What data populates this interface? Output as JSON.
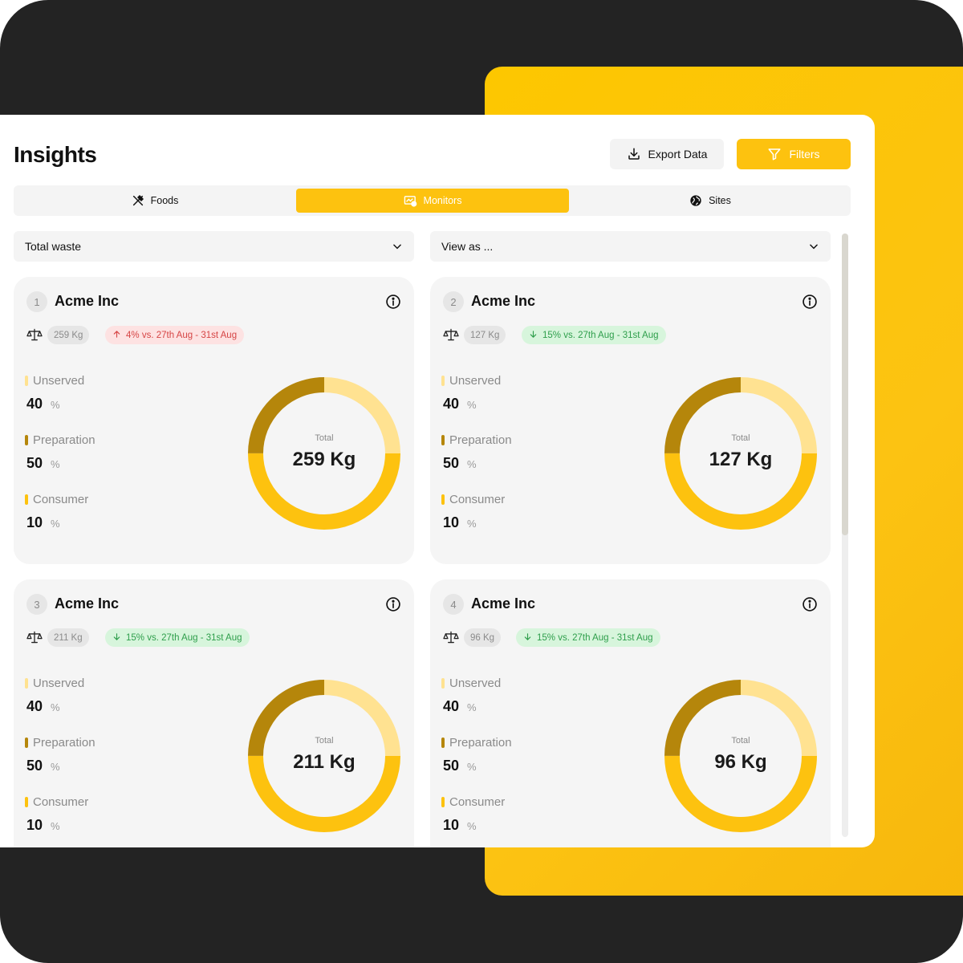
{
  "page": {
    "title": "Insights"
  },
  "toolbar": {
    "export_label": "Export Data",
    "filters_label": "Filters"
  },
  "tabs": [
    {
      "label": "Foods",
      "icon": "fork-knife-icon",
      "active": false
    },
    {
      "label": "Monitors",
      "icon": "monitor-icon",
      "active": true
    },
    {
      "label": "Sites",
      "icon": "globe-icon",
      "active": false
    }
  ],
  "selects": {
    "metric": "Total waste",
    "view": "View as ..."
  },
  "colors": {
    "accent": "#fdc20f",
    "unserved": "#ffe291",
    "preparation": "#b5860b",
    "consumer": "#fdc20f",
    "trend_up_text": "#d64545",
    "trend_down_text": "#2e9e4b"
  },
  "legend_labels": {
    "unserved": "Unserved",
    "preparation": "Preparation",
    "consumer": "Consumer"
  },
  "unit": "%",
  "total_label": "Total",
  "cards": [
    {
      "index": "1",
      "name": "Acme Inc",
      "weight": "259 Kg",
      "trend": {
        "direction": "up",
        "text": "4% vs. 27th Aug - 31st Aug"
      },
      "unserved": 40,
      "preparation": 50,
      "consumer": 10,
      "total": "259 Kg"
    },
    {
      "index": "2",
      "name": "Acme Inc",
      "weight": "127 Kg",
      "trend": {
        "direction": "down",
        "text": "15% vs. 27th Aug - 31st Aug"
      },
      "unserved": 40,
      "preparation": 50,
      "consumer": 10,
      "total": "127 Kg"
    },
    {
      "index": "3",
      "name": "Acme Inc",
      "weight": "211 Kg",
      "trend": {
        "direction": "down",
        "text": "15% vs. 27th Aug - 31st Aug"
      },
      "unserved": 40,
      "preparation": 50,
      "consumer": 10,
      "total": "211 Kg"
    },
    {
      "index": "4",
      "name": "Acme Inc",
      "weight": "96 Kg",
      "trend": {
        "direction": "down",
        "text": "15% vs. 27th Aug - 31st Aug"
      },
      "unserved": 40,
      "preparation": 50,
      "consumer": 10,
      "total": "96 Kg"
    }
  ]
}
